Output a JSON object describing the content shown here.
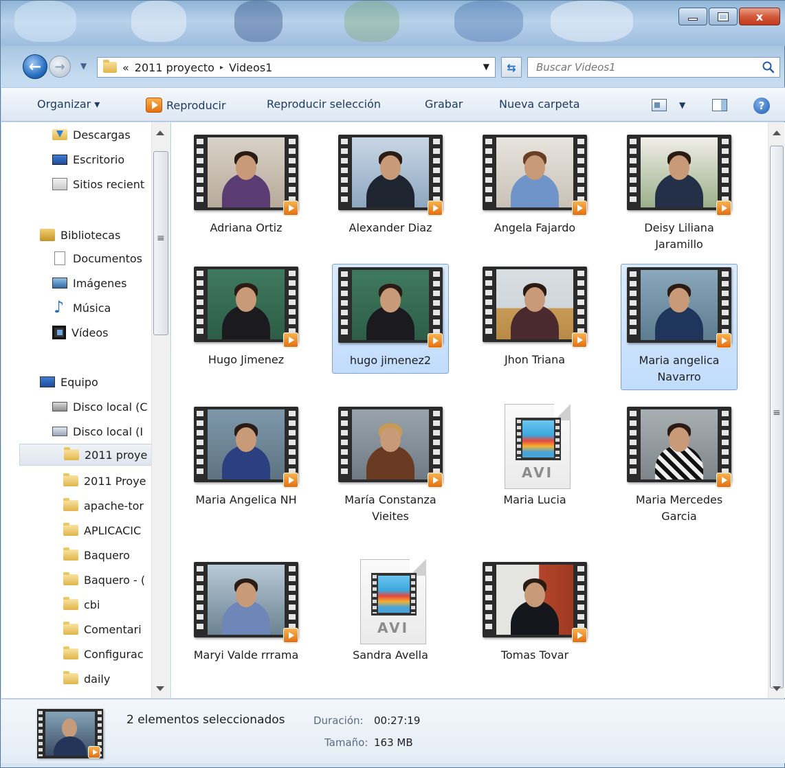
{
  "window": {
    "minimize_glyph": "",
    "close_glyph": "x"
  },
  "address": {
    "overflow_marker": "«",
    "crumbs": [
      "2011 proyecto",
      "Videos1"
    ],
    "separator": "▸",
    "search_placeholder": "Buscar Videos1"
  },
  "toolbar": {
    "organizar": "Organizar ▾",
    "reproducir": "Reproducir",
    "reproducir_seleccion": "Reproducir selección",
    "grabar": "Grabar",
    "nueva_carpeta": "Nueva carpeta",
    "help_glyph": "?"
  },
  "nav": {
    "items": [
      {
        "label": "Descargas",
        "icon": "downloads-icon"
      },
      {
        "label": "Escritorio",
        "icon": "desktop-icon"
      },
      {
        "label": "Sitios recient",
        "icon": "recent-places-icon"
      },
      {
        "label": "Bibliotecas",
        "icon": "libraries-icon"
      },
      {
        "label": "Documentos",
        "icon": "documents-icon"
      },
      {
        "label": "Imágenes",
        "icon": "pictures-icon"
      },
      {
        "label": "Música",
        "icon": "music-icon"
      },
      {
        "label": "Vídeos",
        "icon": "videos-icon"
      },
      {
        "label": "Equipo",
        "icon": "computer-icon"
      },
      {
        "label": "Disco local (C",
        "icon": "local-disk-icon"
      },
      {
        "label": "Disco local (I",
        "icon": "local-disk-icon"
      },
      {
        "label": "2011 proye",
        "icon": "folder-icon"
      },
      {
        "label": "2011 Proye",
        "icon": "folder-icon"
      },
      {
        "label": "apache-tor",
        "icon": "folder-icon"
      },
      {
        "label": "APLICACIC",
        "icon": "folder-icon"
      },
      {
        "label": "Baquero",
        "icon": "folder-icon"
      },
      {
        "label": "Baquero - (",
        "icon": "folder-icon"
      },
      {
        "label": "cbi",
        "icon": "folder-icon"
      },
      {
        "label": "Comentari",
        "icon": "folder-icon"
      },
      {
        "label": "Configurac",
        "icon": "folder-icon"
      },
      {
        "label": "daily",
        "icon": "folder-icon"
      }
    ]
  },
  "files": [
    {
      "name": "Adriana Ortiz",
      "type": "video"
    },
    {
      "name": "Alexander Diaz",
      "type": "video"
    },
    {
      "name": "Angela Fajardo",
      "type": "video"
    },
    {
      "name": "Deisy Liliana Jaramillo",
      "type": "video"
    },
    {
      "name": "Hugo Jimenez",
      "type": "video"
    },
    {
      "name": "hugo jimenez2",
      "type": "video",
      "selected": true
    },
    {
      "name": "Jhon Triana",
      "type": "video"
    },
    {
      "name": "Maria angelica Navarro",
      "type": "video",
      "selected": true
    },
    {
      "name": "Maria Angelica NH",
      "type": "video"
    },
    {
      "name": "María Constanza Vieites",
      "type": "video"
    },
    {
      "name": "Maria Lucia",
      "type": "avi"
    },
    {
      "name": "Maria Mercedes Garcia",
      "type": "video"
    },
    {
      "name": "Maryi Valde rrrama",
      "type": "video"
    },
    {
      "name": "Sandra Avella",
      "type": "avi"
    },
    {
      "name": "Tomas Tovar",
      "type": "video"
    }
  ],
  "avi_label": "AVI",
  "details": {
    "selection_count": "2 elementos seleccionados",
    "duration_label": "Duración:",
    "duration_value": "00:27:19",
    "size_label": "Tamaño:",
    "size_value": "163 MB"
  },
  "colors": {
    "selection_fill": "#cce4fc",
    "selection_border": "#7da2ce",
    "play_badge": "#f08a1c"
  }
}
